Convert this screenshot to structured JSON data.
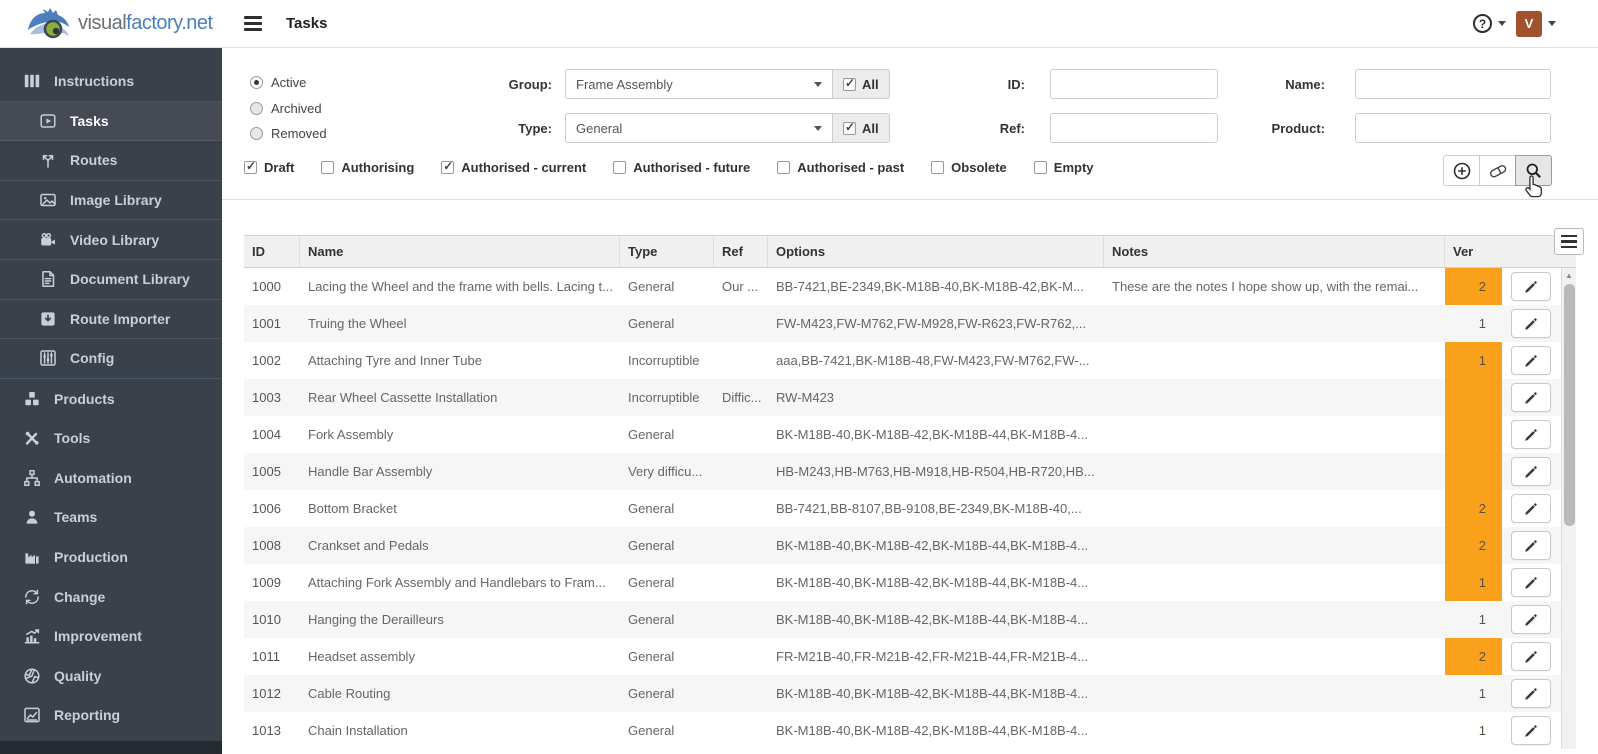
{
  "header": {
    "logo": {
      "visual": "visual",
      "factory": "factory",
      "net": ".net"
    },
    "page_title": "Tasks",
    "avatar_initial": "V"
  },
  "sidebar": {
    "items": [
      {
        "label": "Instructions",
        "icon": "instructions-icon",
        "section": true
      },
      {
        "label": "Tasks",
        "icon": "tasks-icon",
        "indent": true,
        "active": true
      },
      {
        "label": "Routes",
        "icon": "routes-icon",
        "indent": true
      },
      {
        "label": "Image Library",
        "icon": "image-library-icon",
        "indent": true
      },
      {
        "label": "Video Library",
        "icon": "video-library-icon",
        "indent": true
      },
      {
        "label": "Document Library",
        "icon": "document-library-icon",
        "indent": true
      },
      {
        "label": "Route Importer",
        "icon": "route-importer-icon",
        "indent": true
      },
      {
        "label": "Config",
        "icon": "config-icon",
        "indent": true
      },
      {
        "label": "Products",
        "icon": "products-icon"
      },
      {
        "label": "Tools",
        "icon": "tools-icon"
      },
      {
        "label": "Automation",
        "icon": "automation-icon"
      },
      {
        "label": "Teams",
        "icon": "teams-icon"
      },
      {
        "label": "Production",
        "icon": "production-icon"
      },
      {
        "label": "Change",
        "icon": "change-icon"
      },
      {
        "label": "Improvement",
        "icon": "improvement-icon"
      },
      {
        "label": "Quality",
        "icon": "quality-icon"
      },
      {
        "label": "Reporting",
        "icon": "reporting-icon"
      }
    ]
  },
  "filters": {
    "status_options": [
      {
        "label": "Active",
        "selected": true
      },
      {
        "label": "Archived",
        "selected": false
      },
      {
        "label": "Removed",
        "selected": false
      }
    ],
    "group": {
      "label": "Group:",
      "value": "Frame Assembly",
      "all_label": "All",
      "all_checked": true
    },
    "type": {
      "label": "Type:",
      "value": "General",
      "all_label": "All",
      "all_checked": true
    },
    "id_label": "ID:",
    "id_value": "",
    "name_label": "Name:",
    "name_value": "",
    "ref_label": "Ref:",
    "ref_value": "",
    "product_label": "Product:",
    "product_value": "",
    "states": [
      {
        "label": "Draft",
        "checked": true
      },
      {
        "label": "Authorising",
        "checked": false
      },
      {
        "label": "Authorised - current",
        "checked": true
      },
      {
        "label": "Authorised - future",
        "checked": false
      },
      {
        "label": "Authorised - past",
        "checked": false
      },
      {
        "label": "Obsolete",
        "checked": false
      },
      {
        "label": "Empty",
        "checked": false
      }
    ]
  },
  "table": {
    "columns": [
      "ID",
      "Name",
      "Type",
      "Ref",
      "Options",
      "Notes",
      "Ver"
    ],
    "rows": [
      {
        "id": "1000",
        "name": "Lacing the Wheel and the frame with bells. Lacing t...",
        "type": "General",
        "ref": "Our ...",
        "options": "BB-7421,BE-2349,BK-M18B-40,BK-M18B-42,BK-M...",
        "notes": "These are the notes I hope show up, with the remai...",
        "ver": "2",
        "ver_highlight": true
      },
      {
        "id": "1001",
        "name": "Truing the Wheel",
        "type": "General",
        "ref": "",
        "options": "FW-M423,FW-M762,FW-M928,FW-R623,FW-R762,...",
        "notes": "",
        "ver": "1",
        "ver_highlight": false
      },
      {
        "id": "1002",
        "name": "Attaching Tyre and Inner Tube",
        "type": "Incorruptible",
        "ref": "",
        "options": "aaa,BB-7421,BK-M18B-48,FW-M423,FW-M762,FW-...",
        "notes": "",
        "ver": "1",
        "ver_highlight": true
      },
      {
        "id": "1003",
        "name": "Rear Wheel Cassette Installation",
        "type": "Incorruptible",
        "ref": "Diffic...",
        "options": "RW-M423",
        "notes": "",
        "ver": "",
        "ver_highlight": true
      },
      {
        "id": "1004",
        "name": "Fork Assembly",
        "type": "General",
        "ref": "",
        "options": "BK-M18B-40,BK-M18B-42,BK-M18B-44,BK-M18B-4...",
        "notes": "",
        "ver": "",
        "ver_highlight": true
      },
      {
        "id": "1005",
        "name": "Handle Bar Assembly",
        "type": "Very difficu...",
        "ref": "",
        "options": "HB-M243,HB-M763,HB-M918,HB-R504,HB-R720,HB...",
        "notes": "",
        "ver": "",
        "ver_highlight": true
      },
      {
        "id": "1006",
        "name": "Bottom Bracket",
        "type": "General",
        "ref": "",
        "options": "BB-7421,BB-8107,BB-9108,BE-2349,BK-M18B-40,...",
        "notes": "",
        "ver": "2",
        "ver_highlight": true
      },
      {
        "id": "1008",
        "name": "Crankset and Pedals",
        "type": "General",
        "ref": "",
        "options": "BK-M18B-40,BK-M18B-42,BK-M18B-44,BK-M18B-4...",
        "notes": "",
        "ver": "2",
        "ver_highlight": true
      },
      {
        "id": "1009",
        "name": "Attaching Fork Assembly and Handlebars to Fram...",
        "type": "General",
        "ref": "",
        "options": "BK-M18B-40,BK-M18B-42,BK-M18B-44,BK-M18B-4...",
        "notes": "",
        "ver": "1",
        "ver_highlight": true
      },
      {
        "id": "1010",
        "name": "Hanging the Derailleurs",
        "type": "General",
        "ref": "",
        "options": "BK-M18B-40,BK-M18B-42,BK-M18B-44,BK-M18B-4...",
        "notes": "",
        "ver": "1",
        "ver_highlight": false
      },
      {
        "id": "1011",
        "name": "Headset assembly",
        "type": "General",
        "ref": "",
        "options": "FR-M21B-40,FR-M21B-42,FR-M21B-44,FR-M21B-4...",
        "notes": "",
        "ver": "2",
        "ver_highlight": true
      },
      {
        "id": "1012",
        "name": "Cable Routing",
        "type": "General",
        "ref": "",
        "options": "BK-M18B-40,BK-M18B-42,BK-M18B-44,BK-M18B-4...",
        "notes": "",
        "ver": "1",
        "ver_highlight": false
      },
      {
        "id": "1013",
        "name": "Chain Installation",
        "type": "General",
        "ref": "",
        "options": "BK-M18B-40,BK-M18B-42,BK-M18B-44,BK-M18B-4...",
        "notes": "",
        "ver": "1",
        "ver_highlight": false
      }
    ]
  },
  "colors": {
    "accent_orange": "#f9a11b",
    "sidebar_bg": "#3b414b",
    "logo_blue": "#4a7ebd",
    "logo_green": "#8aad3c",
    "avatar_bg": "#a0522d"
  }
}
